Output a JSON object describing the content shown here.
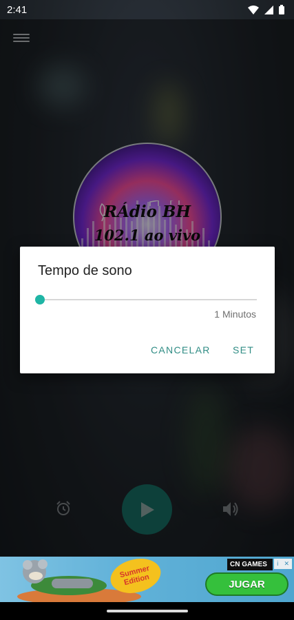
{
  "status_bar": {
    "time": "2:41"
  },
  "station": {
    "logo_line1": "RÁdio BH",
    "logo_line2": "102.1 ao vivo"
  },
  "sleep_dialog": {
    "title": "Tempo de sono",
    "slider_fraction": 0.0,
    "value_label": "1 Minutos",
    "cancel_label": "CANCELAR",
    "set_label": "SET"
  },
  "controls": {
    "alarm": "alarm-icon",
    "play": "play-icon",
    "volume": "volume-icon"
  },
  "ad": {
    "summer_label": "Summer Edition",
    "brand_label": "CN GAMES",
    "cta_label": "JUGAR"
  },
  "colors": {
    "accent": "#1fb5a5",
    "play_button": "#176f64",
    "dialog_button_text": "#2f8c84",
    "ad_cta": "#35c03c"
  }
}
